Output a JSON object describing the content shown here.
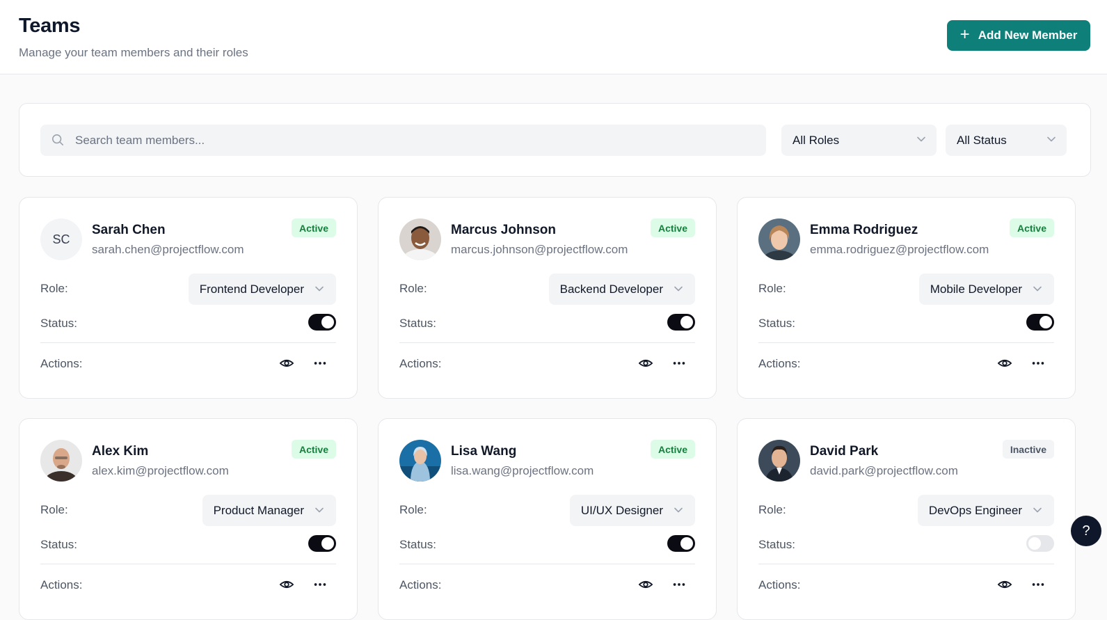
{
  "header": {
    "title": "Teams",
    "subtitle": "Manage your team members and their roles",
    "add_button_label": "Add New Member",
    "add_button_icon": "plus-icon"
  },
  "filters": {
    "search_placeholder": "Search team members...",
    "search_value": "",
    "role_filter": "All Roles",
    "status_filter": "All Status"
  },
  "labels": {
    "role": "Role:",
    "status": "Status:",
    "actions": "Actions:"
  },
  "members": [
    {
      "name": "Sarah Chen",
      "email": "sarah.chen@projectflow.com",
      "role": "Frontend Developer",
      "status": "Active",
      "enabled": true,
      "initials": "SC"
    },
    {
      "name": "Marcus Johnson",
      "email": "marcus.johnson@projectflow.com",
      "role": "Backend Developer",
      "status": "Active",
      "enabled": true
    },
    {
      "name": "Emma Rodriguez",
      "email": "emma.rodriguez@projectflow.com",
      "role": "Mobile Developer",
      "status": "Active",
      "enabled": true
    },
    {
      "name": "Alex Kim",
      "email": "alex.kim@projectflow.com",
      "role": "Product Manager",
      "status": "Active",
      "enabled": true
    },
    {
      "name": "Lisa Wang",
      "email": "lisa.wang@projectflow.com",
      "role": "UI/UX Designer",
      "status": "Active",
      "enabled": true
    },
    {
      "name": "David Park",
      "email": "david.park@projectflow.com",
      "role": "DevOps Engineer",
      "status": "Inactive",
      "enabled": false
    }
  ],
  "help": {
    "label": "?"
  },
  "colors": {
    "accent": "#0f7f79",
    "active_badge_bg": "#dcfce7",
    "active_badge_text": "#15803d",
    "inactive_badge_bg": "#f3f4f6",
    "toggle_on": "#0b0b14",
    "toggle_off": "#e5e7eb"
  }
}
